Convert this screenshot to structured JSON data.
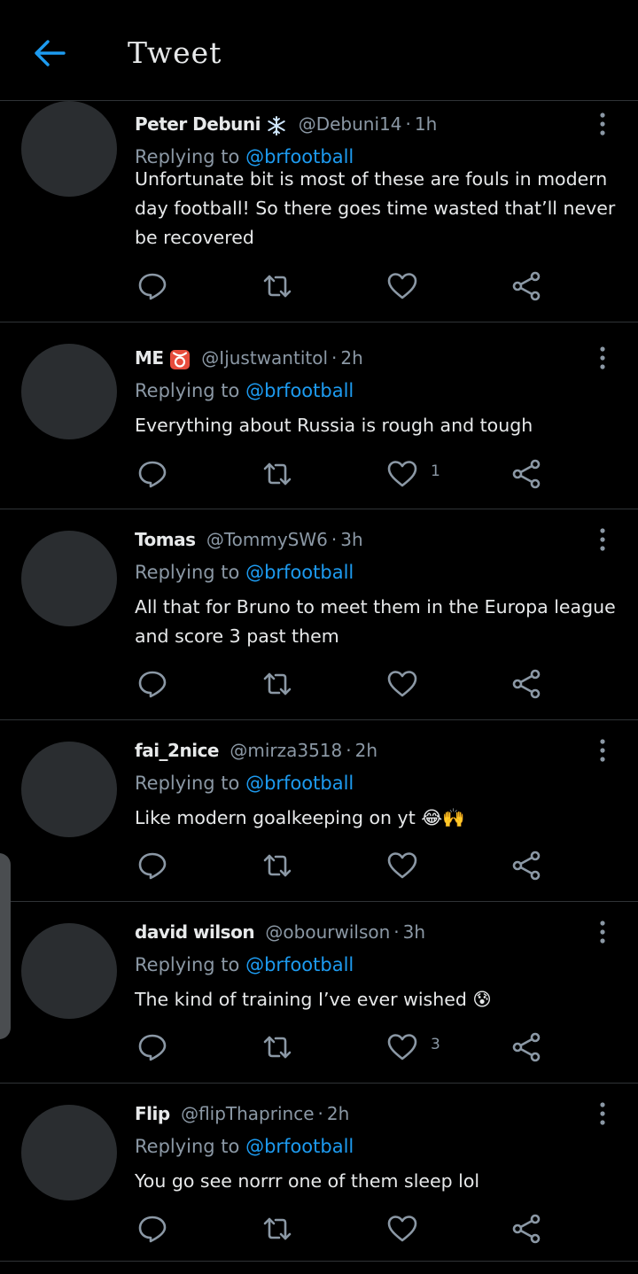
{
  "header": {
    "title": "Tweet",
    "back_icon": "arrow-left-icon",
    "accent": "#1d9bf0"
  },
  "colors": {
    "background": "#000000",
    "text": "#e7e9ea",
    "muted": "#8b98a5",
    "link": "#1d9bf0",
    "divider": "#2f3336"
  },
  "tweets": [
    {
      "name": "Peter Debuni",
      "badge": "snowflake",
      "handle": "@Debuni14",
      "time": "1h",
      "reply_prefix": "Replying to",
      "reply_to": "@brfootball",
      "text": "Unfortunate bit is most of these are fouls in modern day football! So there goes time wasted that’ll never be recovered",
      "likes": "",
      "retweets": "",
      "replies": ""
    },
    {
      "name": "ME",
      "badge": "taurus",
      "handle": "@Ijustwantitol",
      "time": "2h",
      "reply_prefix": "Replying to",
      "reply_to": "@brfootball",
      "text": "Everything about Russia is rough and tough",
      "likes": "1",
      "retweets": "",
      "replies": ""
    },
    {
      "name": "Tomas",
      "badge": "",
      "handle": "@TommySW6",
      "time": "3h",
      "reply_prefix": "Replying to",
      "reply_to": "@brfootball",
      "text": "All that for Bruno to meet them in the Europa league and score 3 past them",
      "likes": "",
      "retweets": "",
      "replies": ""
    },
    {
      "name": "fai_2nice",
      "badge": "",
      "handle": "@mirza3518",
      "time": "2h",
      "reply_prefix": "Replying to",
      "reply_to": "@brfootball",
      "text": "Like modern goalkeeping on yt 😂🙌",
      "likes": "",
      "retweets": "",
      "replies": ""
    },
    {
      "name": "david wilson",
      "badge": "",
      "handle": "@obourwilson",
      "time": "3h",
      "reply_prefix": "Replying to",
      "reply_to": "@brfootball",
      "text": "The kind of training I’ve ever wished 😰",
      "likes": "3",
      "retweets": "",
      "replies": ""
    },
    {
      "name": "Flip",
      "badge": "",
      "handle": "@flipThaprince",
      "time": "2h",
      "reply_prefix": "Replying to",
      "reply_to": "@brfootball",
      "text": "You go see  norrr one of them sleep lol",
      "likes": "",
      "retweets": "",
      "replies": ""
    }
  ],
  "icons": {
    "reply": "reply-icon",
    "retweet": "retweet-icon",
    "like": "heart-icon",
    "share": "share-icon",
    "more": "more-vertical-icon"
  }
}
